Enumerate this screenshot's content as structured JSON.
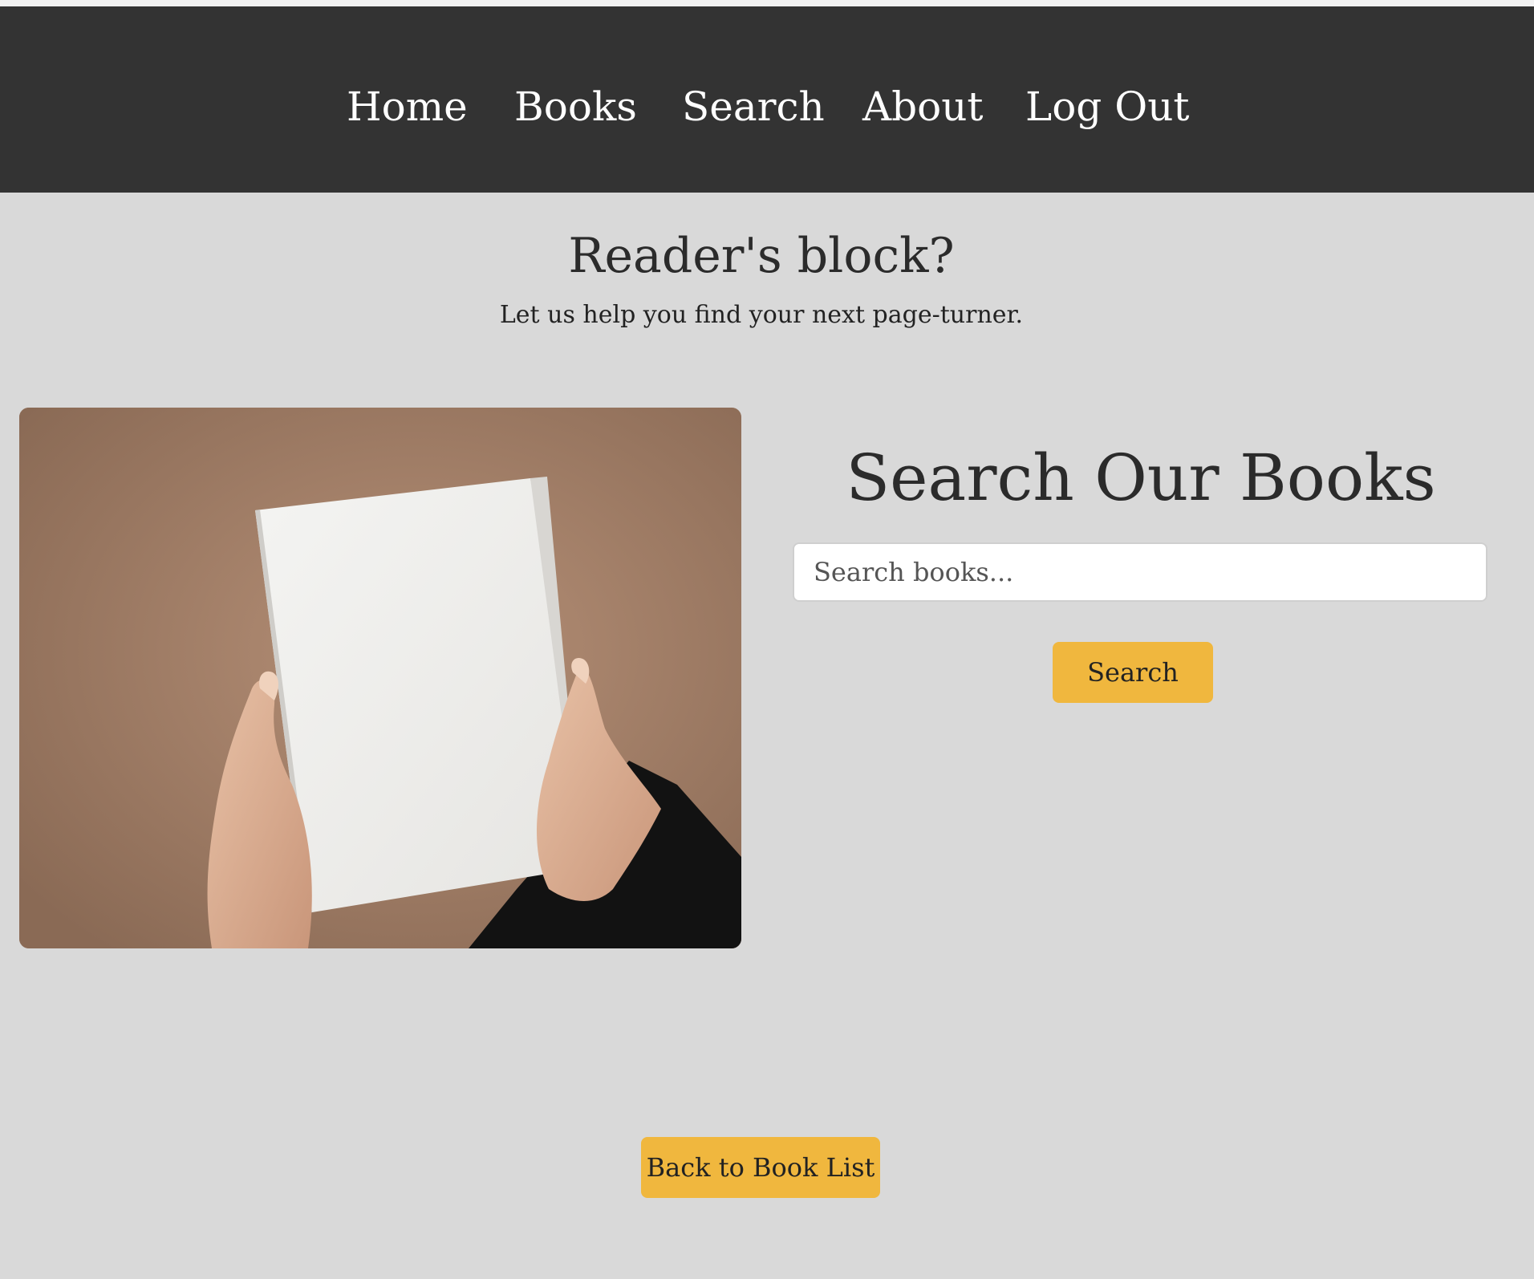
{
  "nav": {
    "items": [
      {
        "label": "Home"
      },
      {
        "label": "Books"
      },
      {
        "label": "Search"
      },
      {
        "label": "About"
      },
      {
        "label": "Log Out"
      }
    ]
  },
  "hero": {
    "title": "Reader's block?",
    "subtitle": "Let us help you find your next page-turner."
  },
  "search": {
    "title": "Search Our Books",
    "placeholder": "Search books...",
    "button_label": "Search"
  },
  "footer": {
    "back_label": "Back to Book List"
  },
  "colors": {
    "navbar": "#333333",
    "page_bg": "#d9d9d9",
    "accent_button": "#f0b73e"
  }
}
